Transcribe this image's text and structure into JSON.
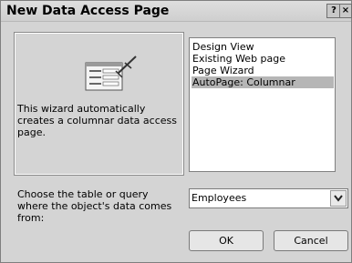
{
  "window": {
    "title": "New Data Access Page",
    "help_label": "?",
    "close_label": "×"
  },
  "left_pane": {
    "description": "This wizard automatically creates a columnar data access page."
  },
  "options": {
    "items": [
      {
        "label": "Design View",
        "selected": false
      },
      {
        "label": "Existing Web page",
        "selected": false
      },
      {
        "label": "Page Wizard",
        "selected": false
      },
      {
        "label": "AutoPage: Columnar",
        "selected": true
      }
    ]
  },
  "source": {
    "label": "Choose the table or query where the object's data comes from:",
    "value": "Employees"
  },
  "buttons": {
    "ok": "OK",
    "cancel": "Cancel"
  }
}
